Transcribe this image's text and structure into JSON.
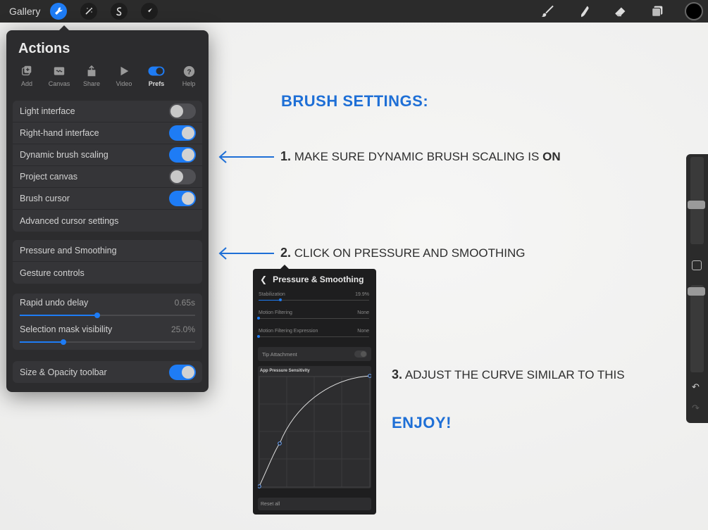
{
  "topbar": {
    "gallery_label": "Gallery",
    "tools": [
      "wrench-icon",
      "magic-wand-icon",
      "selection-icon",
      "transform-icon"
    ],
    "right_tools": [
      "brush-icon",
      "smudge-icon",
      "eraser-icon",
      "layers-icon",
      "color-icon"
    ],
    "accent": "#1e7cf5"
  },
  "actions": {
    "title": "Actions",
    "tabs": [
      {
        "label": "Add",
        "icon": "add-icon"
      },
      {
        "label": "Canvas",
        "icon": "canvas-icon"
      },
      {
        "label": "Share",
        "icon": "share-icon"
      },
      {
        "label": "Video",
        "icon": "video-icon"
      },
      {
        "label": "Prefs",
        "icon": "prefs-toggle-icon",
        "active": true
      },
      {
        "label": "Help",
        "icon": "help-icon"
      }
    ],
    "toggles": [
      {
        "label": "Light interface",
        "on": false
      },
      {
        "label": "Right-hand interface",
        "on": true
      },
      {
        "label": "Dynamic brush scaling",
        "on": true
      },
      {
        "label": "Project canvas",
        "on": false
      },
      {
        "label": "Brush cursor",
        "on": true
      }
    ],
    "advanced_cursor": "Advanced cursor settings",
    "pressure_smoothing": "Pressure and Smoothing",
    "gesture_controls": "Gesture controls",
    "rapid_undo": {
      "label": "Rapid undo delay",
      "value": "0.65s",
      "fraction": 0.44
    },
    "selection_mask": {
      "label": "Selection mask visibility",
      "value": "25.0%",
      "fraction": 0.25
    },
    "size_opacity": {
      "label": "Size & Opacity toolbar",
      "on": true
    }
  },
  "instructions": {
    "heading": "BRUSH SETTINGS:",
    "step1_num": "1.",
    "step1_text": "MAKE SURE DYNAMIC BRUSH SCALING IS",
    "step1_bold": "ON",
    "step2_num": "2.",
    "step2_text": "CLICK ON PRESSURE AND SMOOTHING",
    "step3_num": "3.",
    "step3_text": "ADJUST THE CURVE SIMILAR TO THIS",
    "enjoy": "ENJOY!"
  },
  "pressure_panel": {
    "title": "Pressure & Smoothing",
    "stabilization": {
      "label": "Stabilization",
      "value": "19.9%",
      "fraction": 0.199
    },
    "motion_filtering": {
      "label": "Motion Filtering",
      "value": "None",
      "fraction": 0
    },
    "motion_filtering_expression": {
      "label": "Motion Filtering Expression",
      "value": "None",
      "fraction": 0
    },
    "tip_attachment": "Tip Attachment",
    "curve_label": "App Pressure Sensitivity",
    "reset": "Reset all"
  }
}
